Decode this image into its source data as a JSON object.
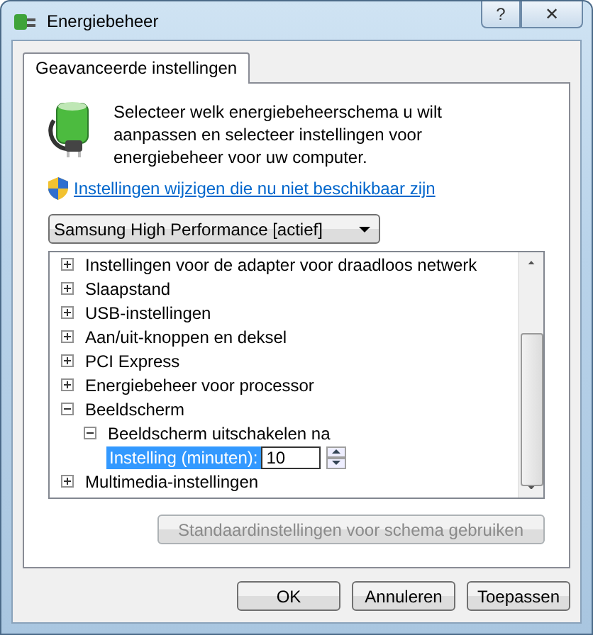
{
  "window": {
    "title": "Energiebeheer",
    "buttons": [
      "?",
      "✕"
    ]
  },
  "tabs": [
    {
      "label": "Geavanceerde instellingen",
      "selected": true
    }
  ],
  "intro": "Selecteer welk energiebeheerschema u wilt aanpassen en selecteer instellingen voor energiebeheer voor uw computer.",
  "link": "Instellingen wijzigen die nu niet beschikbaar zijn",
  "plan_dropdown": {
    "value": "Samsung High Performance [actief]"
  },
  "tree": [
    {
      "label": "Instellingen voor de adapter voor draadloos netwerk",
      "expanded": false
    },
    {
      "label": "Slaapstand",
      "expanded": false
    },
    {
      "label": "USB-instellingen",
      "expanded": false
    },
    {
      "label": "Aan/uit-knoppen en deksel",
      "expanded": false
    },
    {
      "label": "PCI Express",
      "expanded": false
    },
    {
      "label": "Energiebeheer voor processor",
      "expanded": false
    },
    {
      "label": "Beeldscherm",
      "expanded": true,
      "children": [
        {
          "label": "Beeldscherm uitschakelen na",
          "expanded": true,
          "children": [
            {
              "kind": "value",
              "label": "Instelling (minuten):",
              "value": "10",
              "selected": true
            }
          ]
        }
      ]
    },
    {
      "label": "Multimedia-instellingen",
      "expanded": false
    }
  ],
  "restore_button": {
    "label": "Standaardinstellingen voor schema gebruiken",
    "disabled": true
  },
  "buttons": [
    "OK",
    "Annuleren",
    "Toepassen"
  ]
}
